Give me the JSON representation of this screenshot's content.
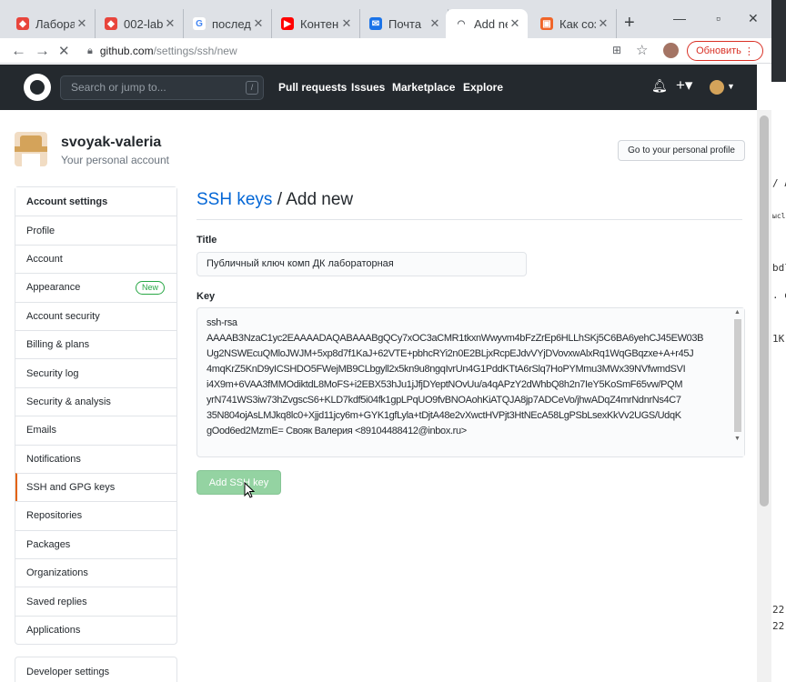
{
  "browser": {
    "tabs": [
      {
        "title": "Лабора",
        "color": "#e8453c",
        "active": false
      },
      {
        "title": "002-lab",
        "color": "#e8453c",
        "active": false
      },
      {
        "title": "послед",
        "color": "#4285f4",
        "active": false
      },
      {
        "title": "Контен",
        "color": "#ff0000",
        "active": false
      },
      {
        "title": "Почта",
        "color": "#1a73e8",
        "active": false
      },
      {
        "title": "Add ne",
        "color": "#5f6368",
        "active": true
      },
      {
        "title": "Как соз",
        "color": "#f06529",
        "active": false
      }
    ],
    "url_host": "github.com",
    "url_path": "/settings/ssh/new",
    "update_button": "Обновить"
  },
  "github_header": {
    "search_placeholder": "Search or jump to...",
    "slash_hint": "/",
    "nav": [
      "Pull requests",
      "Issues",
      "Marketplace",
      "Explore"
    ]
  },
  "profile": {
    "username": "svoyak-valeria",
    "subtitle": "Your personal account",
    "go_profile_button": "Go to your personal profile"
  },
  "sidebar": {
    "heading": "Account settings",
    "items": [
      {
        "label": "Profile"
      },
      {
        "label": "Account"
      },
      {
        "label": "Appearance",
        "badge": "New"
      },
      {
        "label": "Account security"
      },
      {
        "label": "Billing & plans"
      },
      {
        "label": "Security log"
      },
      {
        "label": "Security & analysis"
      },
      {
        "label": "Emails"
      },
      {
        "label": "Notifications"
      },
      {
        "label": "SSH and GPG keys",
        "selected": true
      },
      {
        "label": "Repositories"
      },
      {
        "label": "Packages"
      },
      {
        "label": "Organizations"
      },
      {
        "label": "Saved replies"
      },
      {
        "label": "Applications"
      }
    ],
    "developer_settings": "Developer settings"
  },
  "main": {
    "breadcrumb": "SSH keys",
    "title_rest": " / Add new",
    "title_label": "Title",
    "title_value": "Публичный ключ комп ДК лабораторная",
    "key_label": "Key",
    "key_value": "ssh-rsa\nAAAAB3NzaC1yc2EAAAADAQABAAABgQCy7xOC3aCMR1tkxnWwyvm4bFzZrEp6HLLhSKj5C6BA6yehCJ45EW03B\nUg2NSWEcuQMloJWJM+5xp8d7f1KaJ+62VTE+pbhcRYi2n0E2BLjxRcpEJdvVYjDVovxwAlxRq1WqGBqzxe+A+r45J\n4mqKrZ5KnD9yICSHDO5FWejMB9CLbgyll2x5kn9u8ngqIvrUn4G1PddKTtA6rSlq7HoPYMmu3MWx39NVfwmdSVI\ni4X9m+6VAA3fMMOdiktdL8MoFS+i2EBX53hJu1jJfjDYeptNOvUu/a4qAPzY2dWhbQ8h2n7IeY5KoSmF65vw/PQM\nyrN741WS3iw73hZvgscS6+KLD7kdf5i04fk1gpLPqUO9fvBNOAohKiATQJA8jp7ADCeVo/jhwADqZ4mrNdnrNs4C7\n35N804ojAsLMJkq8lc0+Xjjd11jcy6m+GYK1gfLyla+tDjtA48e2vXwctHVPjt3HtNEcA58LgPSbLsexKkVv2UGS/UdqK\ngOod6ed2MzmE= Свояк Валерия <89104488412@inbox.ru>",
    "add_button": "Add SSH key"
  },
  "background_window": {
    "lines": [
      "/ A",
      "ыcli",
      "bdl",
      ". d",
      "1K",
      "22",
      "22"
    ]
  }
}
